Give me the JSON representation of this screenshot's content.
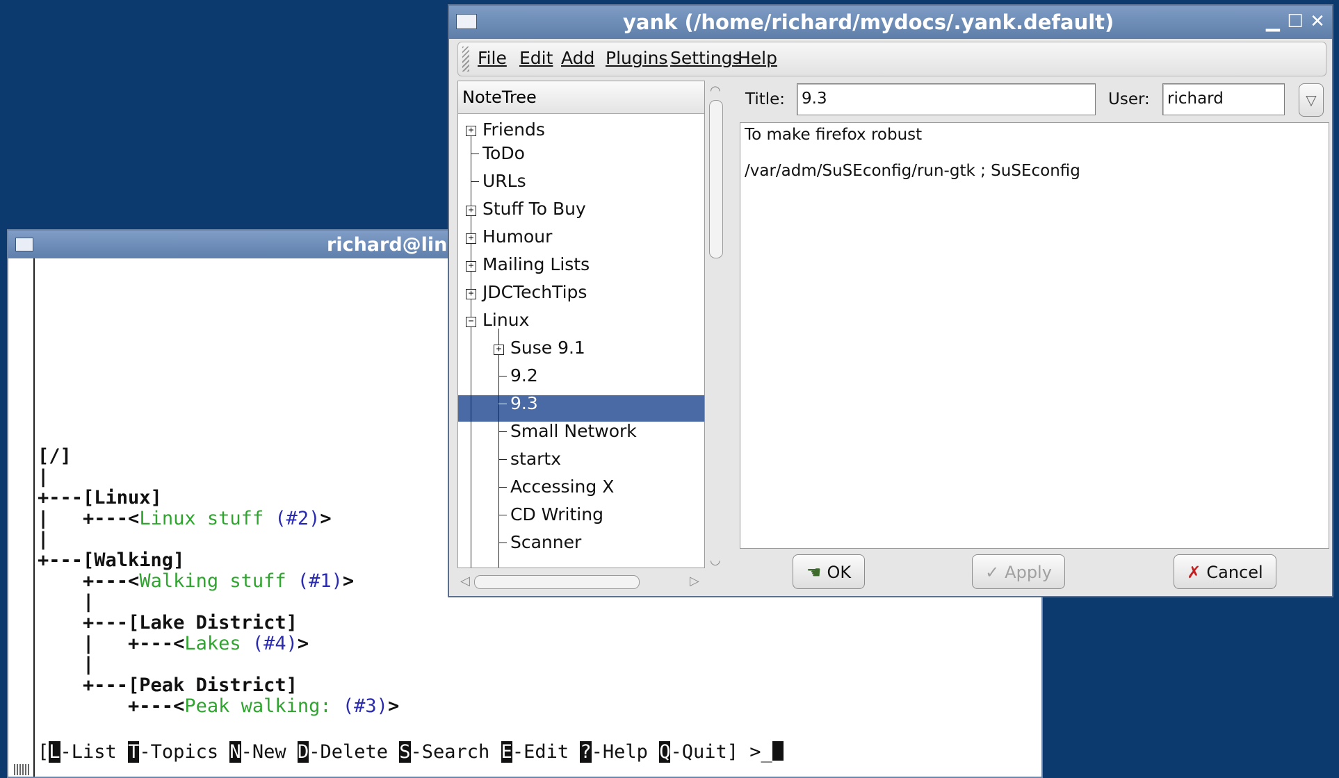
{
  "terminal": {
    "title": "richard@lin",
    "tree_lines": [
      "[/]",
      "|",
      "+---[Linux]",
      "|   +---<Linux stuff (#2)>",
      "|",
      "+---[Walking]",
      "    +---<Walking stuff (#1)>",
      "    |",
      "    +---[Lake District]",
      "    |   +---<Lakes (#4)>",
      "    |",
      "    +---[Peak District]",
      "        +---<Peak walking: (#3)>"
    ],
    "status_keys": [
      {
        "key": "L",
        "label": "-List"
      },
      {
        "key": "T",
        "label": "-Topics"
      },
      {
        "key": "N",
        "label": "-New"
      },
      {
        "key": "D",
        "label": "-Delete"
      },
      {
        "key": "S",
        "label": "-Search"
      },
      {
        "key": "E",
        "label": "-Edit"
      },
      {
        "key": "?",
        "label": "-Help"
      },
      {
        "key": "Q",
        "label": "-Quit"
      }
    ],
    "prompt": "] >_"
  },
  "yank": {
    "title": "yank (/home/richard/mydocs/.yank.default)",
    "menu": {
      "file": "File",
      "edit": "Edit",
      "add": "Add",
      "plugins": "Plugins",
      "settings": "Settings",
      "help": "Help"
    },
    "tree_header": "NoteTree",
    "tree_items": {
      "friends": "Friends",
      "todo": "ToDo",
      "urls": "URLs",
      "stuff": "Stuff To Buy",
      "humour": "Humour",
      "mailing": "Mailing Lists",
      "jdc": "JDCTechTips",
      "linux": "Linux",
      "suse91": "Suse 9.1",
      "v92": "9.2",
      "v93": "9.3",
      "small": "Small Network",
      "startx": "startx",
      "accessing": "Accessing X",
      "cd": "CD Writing",
      "scanner": "Scanner"
    },
    "title_label": "Title:",
    "title_value": "9.3",
    "user_label": "User:",
    "user_value": "richard",
    "note_lines": [
      "To make firefox robust",
      "/var/adm/SuSEconfig/run-gtk ; SuSEconfig"
    ],
    "buttons": {
      "ok": "OK",
      "apply": "Apply",
      "cancel": "Cancel"
    },
    "colors": {
      "selection": "#4a6aa5",
      "desktop": "#0d3a6e",
      "terminal_green": "#2fa52f",
      "terminal_blue": "#2b2bb0"
    }
  }
}
